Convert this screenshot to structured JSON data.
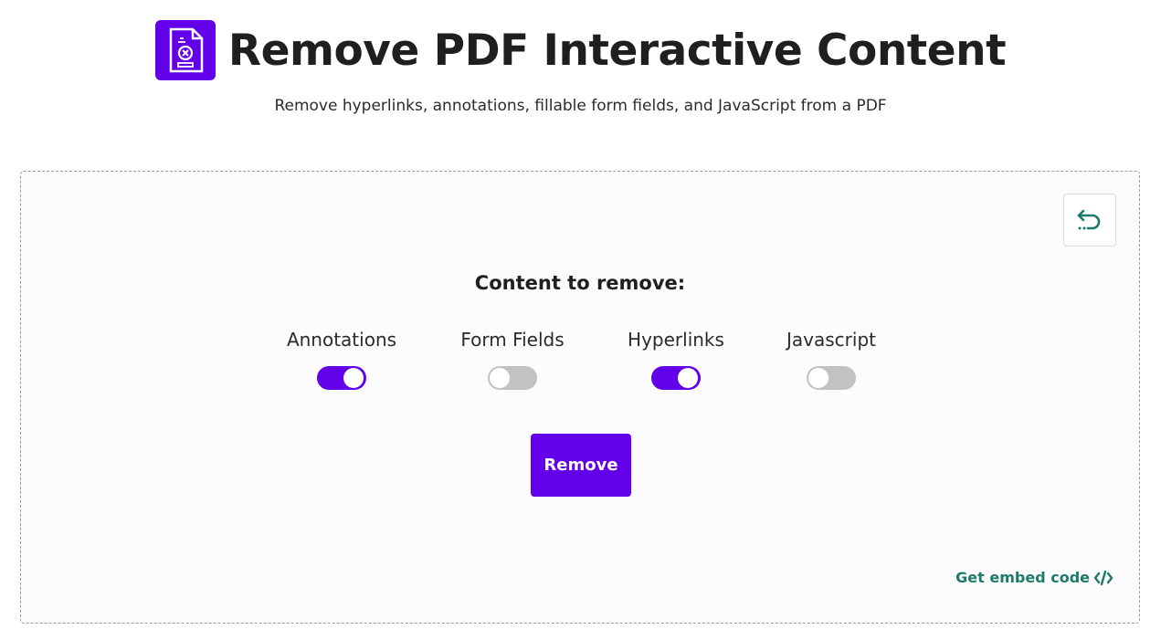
{
  "header": {
    "title": "Remove PDF Interactive Content",
    "subtitle": "Remove hyperlinks, annotations, fillable form fields, and JavaScript from a PDF",
    "logo_icon": "pdf-remove-icon",
    "brand_color": "#6200ea"
  },
  "panel": {
    "reset_icon": "undo-icon",
    "heading": "Content to remove:",
    "toggles": [
      {
        "label": "Annotations",
        "on": true
      },
      {
        "label": "Form Fields",
        "on": false
      },
      {
        "label": "Hyperlinks",
        "on": true
      },
      {
        "label": "Javascript",
        "on": false
      }
    ],
    "remove_label": "Remove",
    "embed_label": "Get embed code",
    "embed_icon": "code-icon",
    "accent_color": "#1e7a6a"
  }
}
